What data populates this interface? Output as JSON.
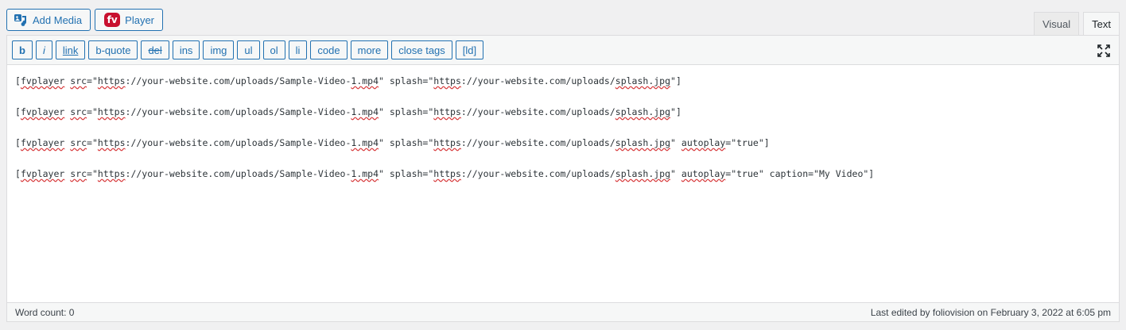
{
  "media_buttons": {
    "add_media": {
      "label": "Add Media",
      "icon": "media-icon"
    },
    "player": {
      "label": "Player",
      "badge": "fv",
      "icon": "fv-player-icon"
    }
  },
  "tabs": [
    {
      "label": "Visual",
      "active": false
    },
    {
      "label": "Text",
      "active": true
    }
  ],
  "toolbar": {
    "buttons": [
      "b",
      "i",
      "link",
      "b-quote",
      "del",
      "ins",
      "img",
      "ul",
      "ol",
      "li",
      "code",
      "more",
      "close tags",
      "[ld]"
    ],
    "fullscreen_icon": "fullscreen-icon"
  },
  "content": {
    "lines": [
      "[fvplayer src=\"https://your-website.com/uploads/Sample-Video-1.mp4\" splash=\"https://your-website.com/uploads/splash.jpg\"]",
      "[fvplayer src=\"https://your-website.com/uploads/Sample-Video-1.mp4\" splash=\"https://your-website.com/uploads/splash.jpg\"]",
      "[fvplayer src=\"https://your-website.com/uploads/Sample-Video-1.mp4\" splash=\"https://your-website.com/uploads/splash.jpg\" autoplay=\"true\"]",
      "[fvplayer src=\"https://your-website.com/uploads/Sample-Video-1.mp4\" splash=\"https://your-website.com/uploads/splash.jpg\" autoplay=\"true\" caption=\"My Video\"]"
    ]
  },
  "status": {
    "word_count": "Word count: 0",
    "last_edited": "Last edited by foliovision on February 3, 2022 at 6:05 pm"
  },
  "colors": {
    "accent": "#2271b1",
    "fv_red": "#c8102e",
    "spell_error": "#d63638"
  }
}
